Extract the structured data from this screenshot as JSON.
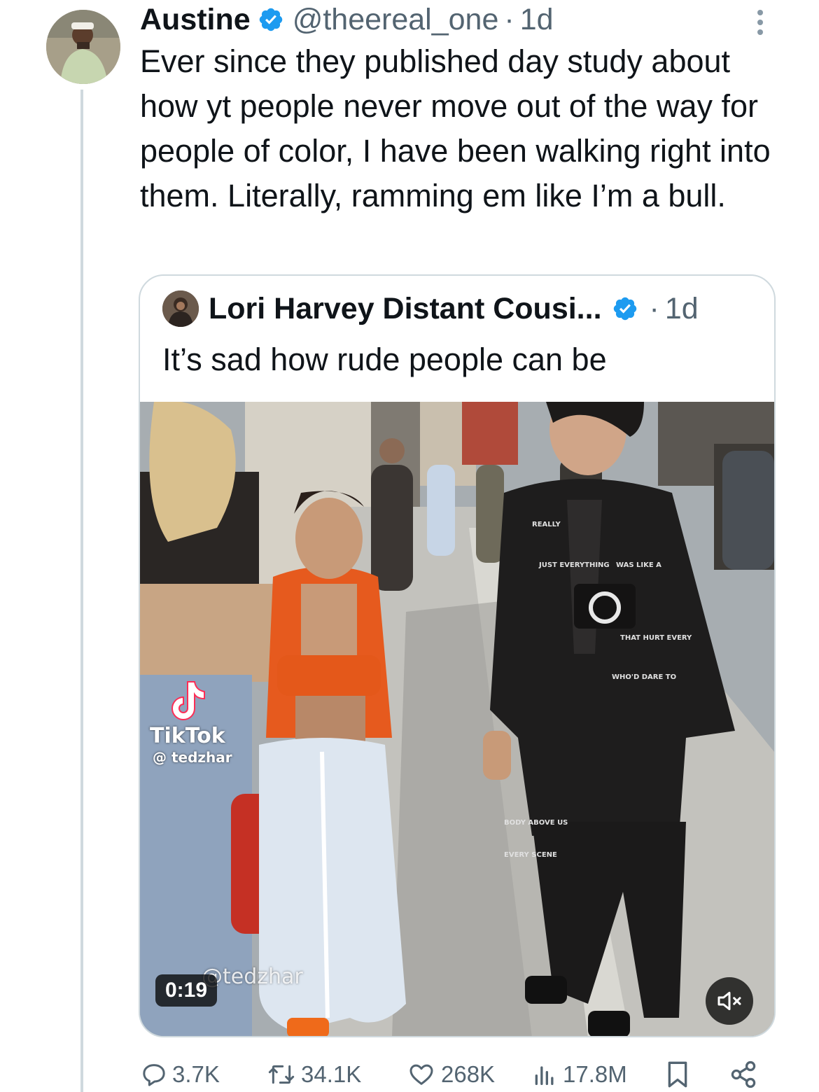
{
  "tweet": {
    "display_name": "Austine",
    "handle": "@theereal_one",
    "separator": "·",
    "time": "1d",
    "text": "Ever since they published day study about how yt people never move out of the way for people of color, I have been walking right into them. Literally, ramming em like I’m a bull.",
    "avatar_icon": "user-avatar",
    "verified_icon": "verified-badge-icon",
    "verified_color": "#1d9bf0"
  },
  "quote": {
    "display_name": "Lori Harvey Distant Cousi...",
    "separator": "·",
    "time": "1d",
    "text": "It’s sad how rude people can be",
    "media": {
      "tiktok_brand": "TikTok",
      "tiktok_handle": "@ tedzhar",
      "watermark": "@tedzhar",
      "duration": "0:19",
      "mute_icon": "speaker-muted-icon"
    }
  },
  "actions": {
    "replies": "3.7K",
    "retweets": "34.1K",
    "likes": "268K",
    "views": "17.8M",
    "reply_icon": "reply-icon",
    "retweet_icon": "retweet-icon",
    "like_icon": "heart-icon",
    "views_icon": "analytics-icon",
    "bookmark_icon": "bookmark-icon",
    "share_icon": "share-icon"
  },
  "colors": {
    "secondary_text": "#536471",
    "border": "#cfd9de",
    "primary_text": "#0f1419"
  }
}
